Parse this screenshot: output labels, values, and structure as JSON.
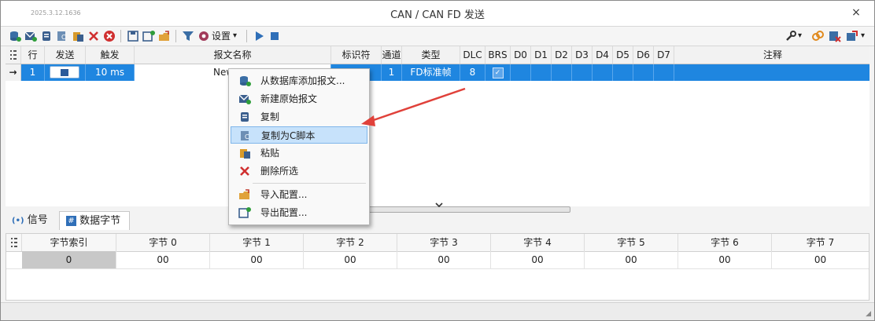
{
  "window": {
    "date_watermark": "2025.3.12.1636",
    "title": "CAN / CAN FD 发送",
    "close_glyph": "×"
  },
  "toolbar": {
    "settings_label": "设置",
    "settings_caret": "▾",
    "wrench_caret": "▾",
    "export_caret": "▾"
  },
  "grid": {
    "columns": [
      "行",
      "发送",
      "触发",
      "报文名称",
      "标识符",
      "通道",
      "类型",
      "DLC",
      "BRS",
      "D0",
      "D1",
      "D2",
      "D3",
      "D4",
      "D5",
      "D6",
      "D7",
      "注释"
    ],
    "row": {
      "indicator": "→",
      "index": "1",
      "trigger": "10 ms",
      "name": "New",
      "channel": "1",
      "type": "FD标准帧",
      "dlc": "8",
      "brs_check": "✓"
    }
  },
  "context_menu": {
    "items": [
      {
        "label": "从数据库添加报文...",
        "icon": "database-add-icon"
      },
      {
        "label": "新建原始报文",
        "icon": "new-message-icon"
      },
      {
        "label": "复制",
        "icon": "copy-icon"
      },
      {
        "label": "复制为C脚本",
        "icon": "copy-c-script-icon"
      },
      {
        "label": "粘贴",
        "icon": "paste-icon"
      },
      {
        "label": "删除所选",
        "icon": "delete-icon"
      },
      {
        "label": "导入配置...",
        "icon": "import-icon"
      },
      {
        "label": "导出配置...",
        "icon": "export-icon"
      }
    ]
  },
  "tabs": {
    "signal_icon": "(•)",
    "signal": "信号",
    "bytes_icon": "#",
    "bytes": "数据字节"
  },
  "bytes": {
    "headers": [
      "字节索引",
      "字节 0",
      "字节 1",
      "字节 2",
      "字节 3",
      "字节 4",
      "字节 5",
      "字节 6",
      "字节 7"
    ],
    "values": [
      "0",
      "00",
      "00",
      "00",
      "00",
      "00",
      "00",
      "00",
      "00"
    ]
  },
  "colors": {
    "selection_blue": "#1f86e0",
    "menu_highlight": "#c7e2fb",
    "arrow_red": "#e0413a"
  }
}
